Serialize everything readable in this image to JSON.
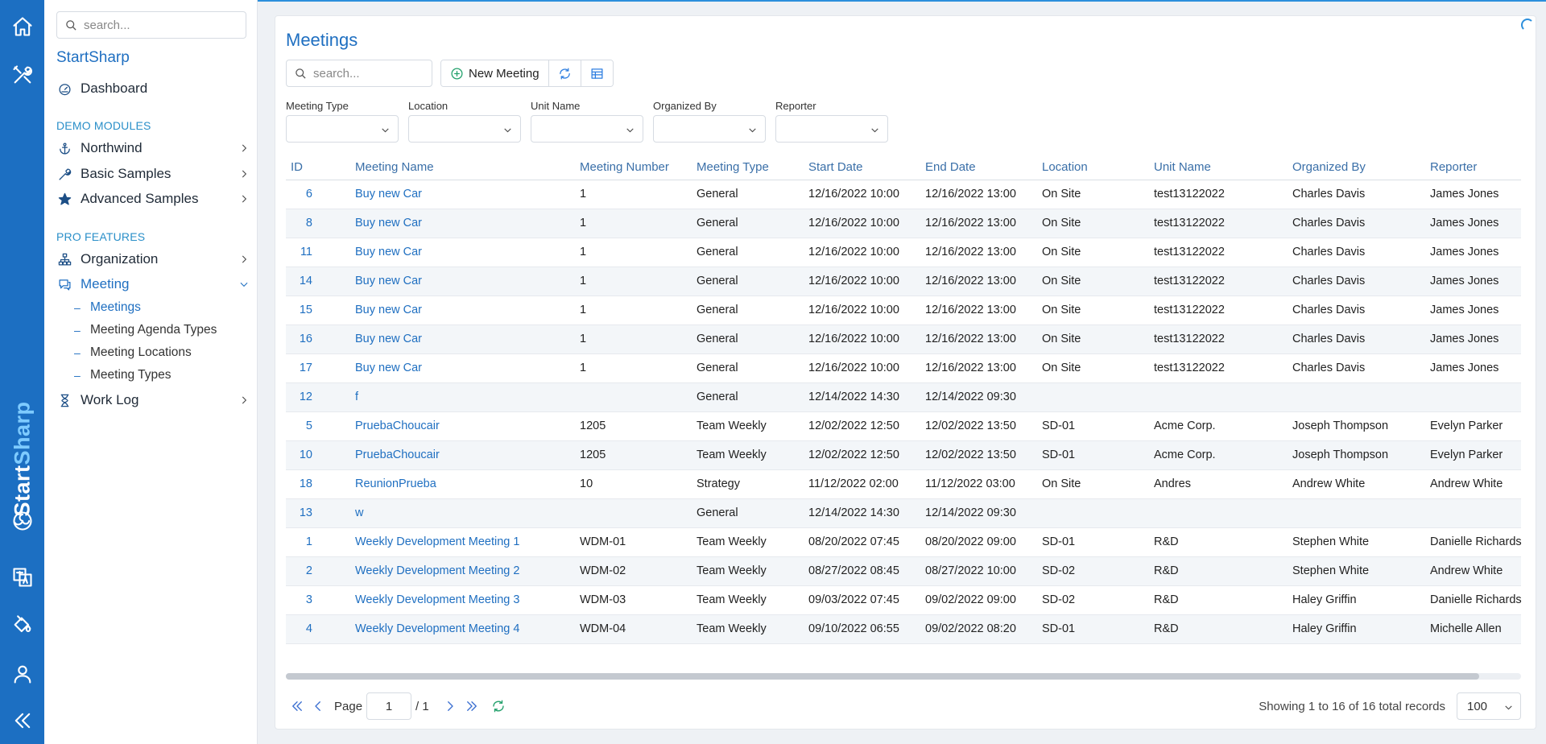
{
  "sidebar": {
    "search_placeholder": "search...",
    "title": "StartSharp",
    "dashboard": "Dashboard",
    "section_demo": "DEMO MODULES",
    "northwind": "Northwind",
    "basic_samples": "Basic Samples",
    "advanced_samples": "Advanced Samples",
    "section_pro": "PRO FEATURES",
    "organization": "Organization",
    "meeting": "Meeting",
    "sub_meetings": "Meetings",
    "sub_agenda_types": "Meeting Agenda Types",
    "sub_locations": "Meeting Locations",
    "sub_types": "Meeting Types",
    "work_log": "Work Log"
  },
  "brand": {
    "part1": "Start",
    "part2": "Sharp"
  },
  "page": {
    "title": "Meetings"
  },
  "toolbar": {
    "search_placeholder": "search...",
    "new_meeting": "New Meeting"
  },
  "filters": {
    "meeting_type": "Meeting Type",
    "location": "Location",
    "unit_name": "Unit Name",
    "organized_by": "Organized By",
    "reporter": "Reporter"
  },
  "columns": {
    "id": "ID",
    "meeting_name": "Meeting Name",
    "meeting_number": "Meeting Number",
    "meeting_type": "Meeting Type",
    "start_date": "Start Date",
    "end_date": "End Date",
    "location": "Location",
    "unit_name": "Unit Name",
    "organized_by": "Organized By",
    "reporter": "Reporter"
  },
  "rows": [
    {
      "id": "6",
      "name": "Buy new Car",
      "number": "1",
      "type": "General",
      "start": "12/16/2022 10:00",
      "end": "12/16/2022 13:00",
      "location": "On Site",
      "unit": "test13122022",
      "organizer": "Charles Davis",
      "reporter": "James Jones"
    },
    {
      "id": "8",
      "name": "Buy new Car",
      "number": "1",
      "type": "General",
      "start": "12/16/2022 10:00",
      "end": "12/16/2022 13:00",
      "location": "On Site",
      "unit": "test13122022",
      "organizer": "Charles Davis",
      "reporter": "James Jones"
    },
    {
      "id": "11",
      "name": "Buy new Car",
      "number": "1",
      "type": "General",
      "start": "12/16/2022 10:00",
      "end": "12/16/2022 13:00",
      "location": "On Site",
      "unit": "test13122022",
      "organizer": "Charles Davis",
      "reporter": "James Jones"
    },
    {
      "id": "14",
      "name": "Buy new Car",
      "number": "1",
      "type": "General",
      "start": "12/16/2022 10:00",
      "end": "12/16/2022 13:00",
      "location": "On Site",
      "unit": "test13122022",
      "organizer": "Charles Davis",
      "reporter": "James Jones"
    },
    {
      "id": "15",
      "name": "Buy new Car",
      "number": "1",
      "type": "General",
      "start": "12/16/2022 10:00",
      "end": "12/16/2022 13:00",
      "location": "On Site",
      "unit": "test13122022",
      "organizer": "Charles Davis",
      "reporter": "James Jones"
    },
    {
      "id": "16",
      "name": "Buy new Car",
      "number": "1",
      "type": "General",
      "start": "12/16/2022 10:00",
      "end": "12/16/2022 13:00",
      "location": "On Site",
      "unit": "test13122022",
      "organizer": "Charles Davis",
      "reporter": "James Jones"
    },
    {
      "id": "17",
      "name": "Buy new Car",
      "number": "1",
      "type": "General",
      "start": "12/16/2022 10:00",
      "end": "12/16/2022 13:00",
      "location": "On Site",
      "unit": "test13122022",
      "organizer": "Charles Davis",
      "reporter": "James Jones"
    },
    {
      "id": "12",
      "name": "f",
      "number": "",
      "type": "General",
      "start": "12/14/2022 14:30",
      "end": "12/14/2022 09:30",
      "location": "",
      "unit": "",
      "organizer": "",
      "reporter": ""
    },
    {
      "id": "5",
      "name": "PruebaChoucair",
      "number": "1205",
      "type": "Team Weekly",
      "start": "12/02/2022 12:50",
      "end": "12/02/2022 13:50",
      "location": "SD-01",
      "unit": "Acme Corp.",
      "organizer": "Joseph Thompson",
      "reporter": "Evelyn Parker"
    },
    {
      "id": "10",
      "name": "PruebaChoucair",
      "number": "1205",
      "type": "Team Weekly",
      "start": "12/02/2022 12:50",
      "end": "12/02/2022 13:50",
      "location": "SD-01",
      "unit": "Acme Corp.",
      "organizer": "Joseph Thompson",
      "reporter": "Evelyn Parker"
    },
    {
      "id": "18",
      "name": "ReunionPrueba",
      "number": "10",
      "type": "Strategy",
      "start": "11/12/2022 02:00",
      "end": "11/12/2022 03:00",
      "location": "On Site",
      "unit": "Andres",
      "organizer": "Andrew White",
      "reporter": "Andrew White"
    },
    {
      "id": "13",
      "name": "w",
      "number": "",
      "type": "General",
      "start": "12/14/2022 14:30",
      "end": "12/14/2022 09:30",
      "location": "",
      "unit": "",
      "organizer": "",
      "reporter": ""
    },
    {
      "id": "1",
      "name": "Weekly Development Meeting 1",
      "number": "WDM-01",
      "type": "Team Weekly",
      "start": "08/20/2022 07:45",
      "end": "08/20/2022 09:00",
      "location": "SD-01",
      "unit": "R&D",
      "organizer": "Stephen White",
      "reporter": "Danielle Richards"
    },
    {
      "id": "2",
      "name": "Weekly Development Meeting 2",
      "number": "WDM-02",
      "type": "Team Weekly",
      "start": "08/27/2022 08:45",
      "end": "08/27/2022 10:00",
      "location": "SD-02",
      "unit": "R&D",
      "organizer": "Stephen White",
      "reporter": "Andrew White"
    },
    {
      "id": "3",
      "name": "Weekly Development Meeting 3",
      "number": "WDM-03",
      "type": "Team Weekly",
      "start": "09/03/2022 07:45",
      "end": "09/02/2022 09:00",
      "location": "SD-02",
      "unit": "R&D",
      "organizer": "Haley Griffin",
      "reporter": "Danielle Richards"
    },
    {
      "id": "4",
      "name": "Weekly Development Meeting 4",
      "number": "WDM-04",
      "type": "Team Weekly",
      "start": "09/10/2022 06:55",
      "end": "09/02/2022 08:20",
      "location": "SD-01",
      "unit": "R&D",
      "organizer": "Haley Griffin",
      "reporter": "Michelle Allen"
    }
  ],
  "pager": {
    "page_label": "Page",
    "page_value": "1",
    "total_pages": "/ 1",
    "info": "Showing 1 to 16 of 16 total records",
    "page_size": "100"
  },
  "colors": {
    "rail": "#1c6fc2",
    "accent": "#1f6fc1",
    "refresh": "#22a06b"
  },
  "icons": [
    "home-icon",
    "tools-icon",
    "translate-icon",
    "paint-bucket-icon",
    "user-icon",
    "collapse-icon",
    "search-icon",
    "dashboard-icon",
    "anchor-icon",
    "wrench-icon",
    "star-icon",
    "sitemap-icon",
    "chat-icon",
    "hourglass-icon",
    "add-circle-icon",
    "refresh-icon",
    "table-icon"
  ]
}
